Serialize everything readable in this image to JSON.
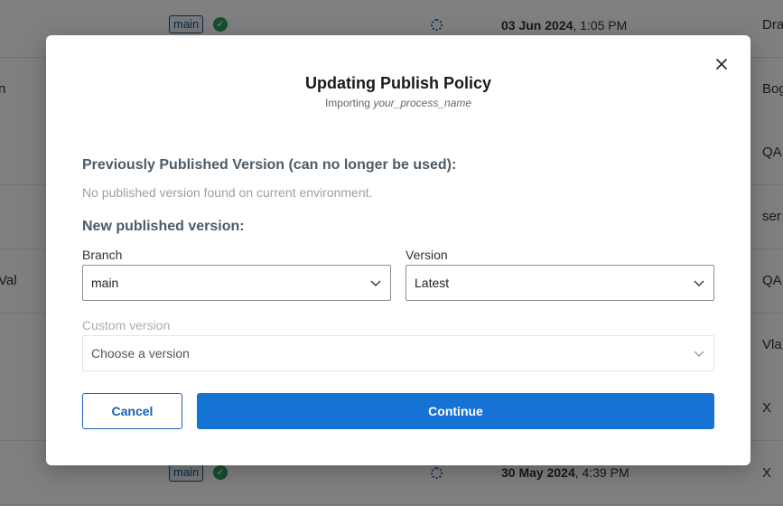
{
  "background_rows": [
    {
      "left": "",
      "branch": "main",
      "date_bold": "03 Jun 2024",
      "date_time": ", 1:05 PM",
      "right": "Dra"
    },
    {
      "left": "n",
      "branch": "",
      "date_bold": "",
      "date_time": "",
      "right": "Bog"
    },
    {
      "left": "",
      "branch": "",
      "date_bold": "",
      "date_time": "",
      "right": "QA"
    },
    {
      "left": "",
      "branch": "",
      "date_bold": "",
      "date_time": "",
      "right": "ser"
    },
    {
      "left": "Val",
      "branch": "",
      "date_bold": "",
      "date_time": "",
      "right": "QA"
    },
    {
      "left": "",
      "branch": "",
      "date_bold": "",
      "date_time": "",
      "right": "Vla"
    },
    {
      "left": "",
      "branch": "",
      "date_bold": "",
      "date_time": "",
      "right": "X"
    },
    {
      "left": "",
      "branch": "main",
      "date_bold": "30 May 2024",
      "date_time": ", 4:39 PM",
      "right": "X"
    }
  ],
  "modal": {
    "title": "Updating Publish Policy",
    "subtitle_prefix": "Importing ",
    "subtitle_name": "your_process_name",
    "previous_heading": "Previously Published Version (can no longer be used):",
    "previous_note": "No published version found on current environment.",
    "new_heading": "New published version:",
    "branch_label": "Branch",
    "branch_value": "main",
    "version_label": "Version",
    "version_value": "Latest",
    "custom_label": "Custom version",
    "custom_placeholder": "Choose a version",
    "cancel_label": "Cancel",
    "continue_label": "Continue"
  },
  "icons": [
    "close-icon",
    "chevron-down-icon",
    "check-circle-icon",
    "spinner-icon"
  ],
  "colors": {
    "primary": "#1673d6",
    "cancel_border": "#1a5fb4",
    "heading": "#4d5b66",
    "overlay": "rgba(0,0,0,0.5)",
    "success": "#2e9c5c"
  }
}
